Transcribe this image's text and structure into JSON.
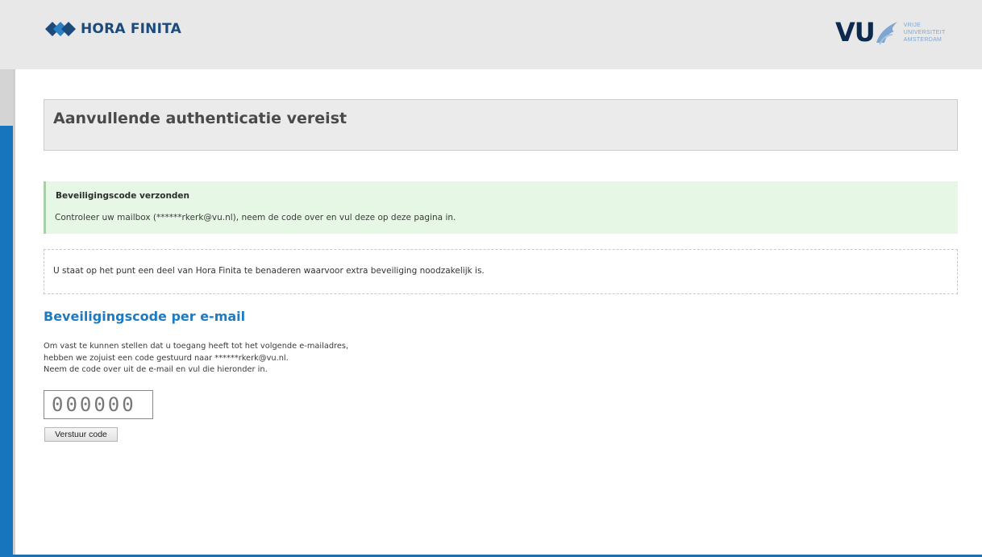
{
  "header": {
    "app_name": "HORA FINITA",
    "university_abbrev": "VU",
    "university_name_lines": [
      "VRIJE",
      "UNIVERSITEIT",
      "AMSTERDAM"
    ],
    "logo_icon": "diamond-logo-icon",
    "brand_color": "#1c4a7a"
  },
  "page": {
    "title": "Aanvullende authenticatie vereist"
  },
  "success_notice": {
    "title": "Beveiligingscode verzonden",
    "message": "Controleer uw mailbox (******rkerk@vu.nl), neem de code over en vul deze op deze pagina in."
  },
  "info_notice": {
    "message": "U staat op het punt een deel van Hora Finita te benaderen waarvoor extra beveiliging noodzakelijk is."
  },
  "email_section": {
    "heading": "Beveiligingscode per e-mail",
    "lines": [
      "Om vast te kunnen stellen dat u toegang heeft tot het volgende e-mailadres,",
      "hebben we zojuist een code gestuurd naar ******rkerk@vu.nl.",
      "Neem de code over uit de e-mail en vul die hieronder in."
    ],
    "code_placeholder": "000000",
    "code_value": "",
    "submit_label": "Verstuur code"
  },
  "colors": {
    "accent_blue": "#1675bd",
    "heading_blue": "#1e7bc2",
    "success_bg": "#e6f7e6"
  }
}
